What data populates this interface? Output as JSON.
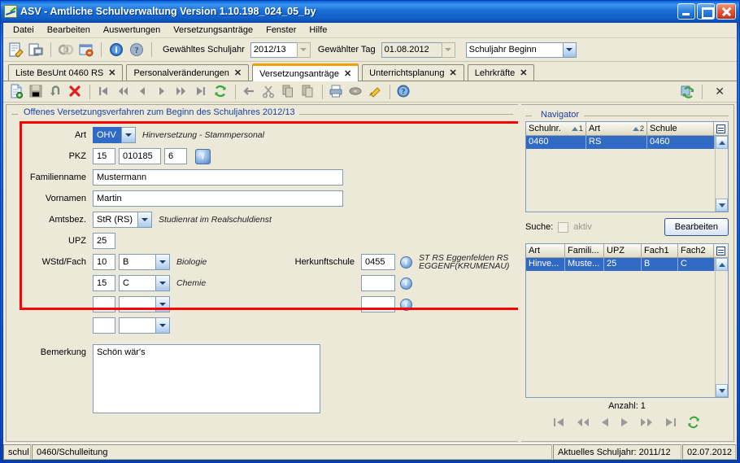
{
  "window": {
    "title": "ASV - Amtliche Schulverwaltung Version 1.10.198_024_05_by",
    "icon": "app-chart-icon",
    "minimize": "Minimieren",
    "maximize": "Maximieren",
    "close": "Schließen"
  },
  "menu": [
    {
      "label": "Datei"
    },
    {
      "label": "Bearbeiten"
    },
    {
      "label": "Auswertungen"
    },
    {
      "label": "Versetzungsanträge"
    },
    {
      "label": "Fenster"
    },
    {
      "label": "Hilfe"
    }
  ],
  "app_toolbar": {
    "icons": [
      "edit-document-icon",
      "print-preview-icon",
      "link-icon",
      "window-close-icon",
      "info-icon",
      "help-icon"
    ],
    "schuljahr_label": "Gewähltes Schuljahr",
    "schuljahr_value": "2012/13",
    "tag_label": "Gewählter Tag",
    "tag_value": "01.08.2012",
    "zeitpunkt_value": "Schuljahr Beginn"
  },
  "tabs": [
    {
      "label": "Liste BesUnt 0460 RS",
      "active": false
    },
    {
      "label": "Personalveränderungen",
      "active": false
    },
    {
      "label": "Versetzungsanträge",
      "active": true
    },
    {
      "label": "Unterrichtsplanung",
      "active": false
    },
    {
      "label": "Lehrkräfte",
      "active": false
    }
  ],
  "tab_close_glyph": "✕",
  "inner_toolbar": {
    "icons": [
      "new-document-icon",
      "save-icon",
      "undo-icon",
      "delete-icon",
      "first-record-icon",
      "fast-rewind-icon",
      "previous-record-icon",
      "next-record-icon",
      "fast-forward-icon",
      "last-record-icon",
      "refresh-icon",
      "back-arrow-icon",
      "cut-icon",
      "copy-icon",
      "paste-icon",
      "print-icon",
      "record-icon",
      "bell-icon",
      "help-icon"
    ],
    "right_refresh": "refresh-window-icon",
    "close_label": "✕"
  },
  "groupbox": {
    "legend": "Offenes Versetzungsverfahren zum Beginn des Schuljahres 2012/13",
    "highlight_color": "#ff0000"
  },
  "form": {
    "art_label": "Art",
    "art_value": "OHV",
    "art_desc": "Hinversetzung - Stammpersonal",
    "pkz_label": "PKZ",
    "pkz_1": "15",
    "pkz_2": "010185",
    "pkz_3": "6",
    "familienname_label": "Familienname",
    "familienname_value": "Mustermann",
    "vornamen_label": "Vornamen",
    "vornamen_value": "Martin",
    "amtsbez_label": "Amtsbez.",
    "amtsbez_value": "StR (RS)",
    "amtsbez_desc": "Studienrat im Realschuldienst",
    "upz_label": "UPZ",
    "upz_value": "25",
    "wstd_label": "WStd/Fach",
    "wstd_rows": [
      {
        "stunden": "10",
        "fach": "B",
        "desc": "Biologie"
      },
      {
        "stunden": "15",
        "fach": "C",
        "desc": "Chemie"
      },
      {
        "stunden": "",
        "fach": "",
        "desc": ""
      },
      {
        "stunden": "",
        "fach": "",
        "desc": ""
      }
    ],
    "herkunftschule_label": "Herkunftschule",
    "herkunft_rows": [
      {
        "value": "0455",
        "desc_line1": "ST RS Eggenfelden RS",
        "desc_line2": "EGGENF(KRUMENAU)"
      },
      {
        "value": "",
        "desc_line1": "",
        "desc_line2": ""
      },
      {
        "value": "",
        "desc_line1": "",
        "desc_line2": ""
      }
    ],
    "bemerkung_label": "Bemerkung",
    "bemerkung_value": "Schön wär's"
  },
  "navigator": {
    "legend": "Navigator",
    "grid1": {
      "columns": [
        {
          "label": "Schulnr.",
          "sort": "1"
        },
        {
          "label": "Art",
          "sort": "2"
        },
        {
          "label": "Schule",
          "sort": ""
        }
      ],
      "rows": [
        {
          "cells": [
            "0460",
            "RS",
            "0460"
          ],
          "selected": true
        }
      ],
      "corner_icon": "column-chooser-icon"
    },
    "suche_label": "Suche:",
    "aktiv_label": "aktiv",
    "aktiv_checked": false,
    "bearbeiten_label": "Bearbeiten",
    "grid2": {
      "columns": [
        {
          "label": "Art"
        },
        {
          "label": "Famili..."
        },
        {
          "label": "UPZ"
        },
        {
          "label": "Fach1"
        },
        {
          "label": "Fach2"
        }
      ],
      "rows": [
        {
          "cells": [
            "Hinve...",
            "Muste...",
            "25",
            "B",
            "C"
          ],
          "selected": true
        }
      ],
      "corner_icon": "column-chooser-icon"
    },
    "anzahl_label": "Anzahl: 1",
    "nav_buttons": [
      "first-record-icon",
      "fast-rewind-icon",
      "previous-record-icon",
      "next-record-icon",
      "fast-forward-icon",
      "last-record-icon",
      "refresh-icon"
    ]
  },
  "statusbar": {
    "user": "schul",
    "context": "0460/Schulleitung",
    "schuljahr": "Aktuelles Schuljahr: 2011/12",
    "date": "02.07.2012"
  }
}
